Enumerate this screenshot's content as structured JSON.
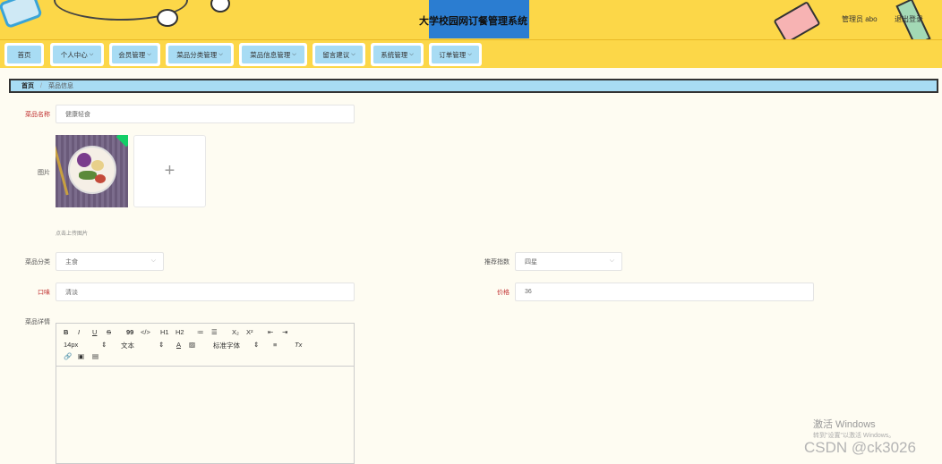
{
  "header": {
    "title": "大学校园网订餐管理系统",
    "admin_label": "管理员 abo",
    "logout_label": "退出登录"
  },
  "nav": {
    "items": [
      {
        "label": "首页",
        "has_dropdown": false
      },
      {
        "label": "个人中心",
        "has_dropdown": true
      },
      {
        "label": "会员管理",
        "has_dropdown": true
      },
      {
        "label": "菜品分类管理",
        "has_dropdown": true
      },
      {
        "label": "菜品信息管理",
        "has_dropdown": true
      },
      {
        "label": "留言建议",
        "has_dropdown": true
      },
      {
        "label": "系统管理",
        "has_dropdown": true
      },
      {
        "label": "订单管理",
        "has_dropdown": true
      }
    ],
    "dropdown_icon": "chevron-down"
  },
  "breadcrumb": {
    "home": "首页",
    "separator": "/",
    "current": "菜品信息"
  },
  "form": {
    "dish_name": {
      "label": "菜品名称",
      "value": "健康轻食"
    },
    "image": {
      "label": "图片",
      "hint": "点击上传图片",
      "upload_symbol": "+"
    },
    "category": {
      "label": "菜品分类",
      "value": "主食"
    },
    "recommend": {
      "label": "推荐指数",
      "value": "四星"
    },
    "taste": {
      "label": "口味",
      "value": "清淡"
    },
    "price": {
      "label": "价格",
      "value": "36"
    },
    "details": {
      "label": "菜品详情"
    }
  },
  "editor": {
    "row1": [
      "B",
      "I",
      "U",
      "S",
      "99",
      "</>",
      "H1",
      "H2",
      "≔",
      "☰",
      "X₂",
      "X²",
      "⇤",
      "⇥"
    ],
    "font_size": "14px",
    "text_type": "文本",
    "font_family": "标准字体",
    "font_color": "A",
    "align": "≡",
    "clear": "Tx",
    "row3_icons": [
      "link-icon",
      "image-icon",
      "video-icon"
    ]
  },
  "watermark": {
    "activate_title": "激活 Windows",
    "activate_hint": "转到\"设置\"以激活 Windows。",
    "csdn": "CSDN @ck3026"
  },
  "colors": {
    "header_bg": "#fcd748",
    "nav_item_bg": "#a8dcf4",
    "title_highlight": "#2b7dd1",
    "page_bg": "#fefcf2",
    "required_label": "#c03030"
  }
}
